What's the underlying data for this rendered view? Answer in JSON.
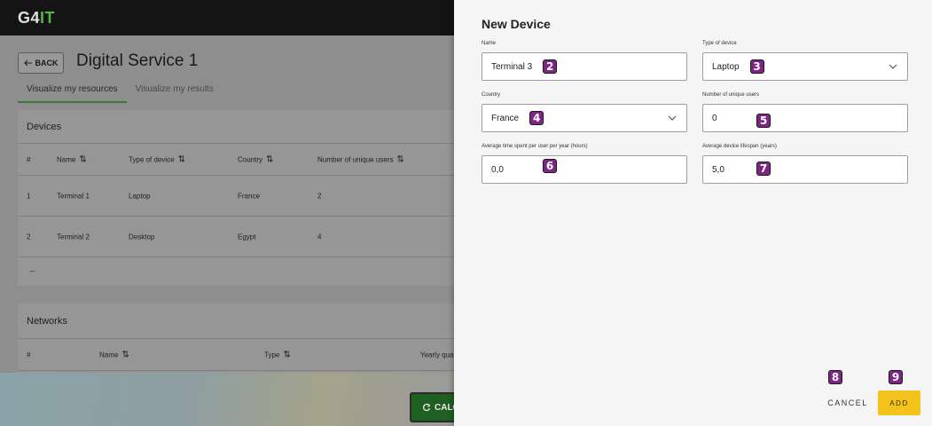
{
  "app": {
    "logo_prefix": "G4",
    "logo_highlight": "IT",
    "back_label": "BACK",
    "page_title": "Digital Service 1",
    "tabs": [
      {
        "label": "Visualize my resources",
        "active": true
      },
      {
        "label": "Visualize my results",
        "active": false
      }
    ],
    "devices": {
      "title": "Devices",
      "columns": [
        "#",
        "Name",
        "Type of device",
        "Country",
        "Number of unique users"
      ],
      "rows": [
        {
          "num": "1",
          "name": "Terminal 1",
          "type": "Laptop",
          "country": "France",
          "users": "2"
        },
        {
          "num": "2",
          "name": "Terminal 2",
          "type": "Desktop",
          "country": "Egypt",
          "users": "4"
        }
      ],
      "prev_arrow": "←"
    },
    "networks": {
      "title": "Networks",
      "columns": [
        "#",
        "Name",
        "Type",
        "Yearly qua"
      ],
      "prev_arrow": "←"
    },
    "calculate_label": "CALC",
    "sort_icon": "⇅",
    "accent_color": "#3a7a32"
  },
  "panel": {
    "title": "New Device",
    "fields": {
      "name": {
        "label": "Name",
        "value": "Terminal 3",
        "marker": "2"
      },
      "type": {
        "label": "Type of device",
        "value": "Laptop",
        "marker": "3"
      },
      "country": {
        "label": "Country",
        "value": "France",
        "marker": "4"
      },
      "users": {
        "label": "Number of unique users",
        "value": "0",
        "marker": "5"
      },
      "time": {
        "label": "Average time spent per user per year (hours)",
        "value": "0,0",
        "marker": "6"
      },
      "lifespan": {
        "label": "Average device lifespan (years)",
        "value": "5,0",
        "marker": "7"
      }
    },
    "cancel_label": "CANCEL",
    "cancel_marker": "8",
    "add_label": "ADD",
    "add_marker": "9",
    "add_color": "#f4c31b",
    "marker_color": "#7d2583"
  }
}
